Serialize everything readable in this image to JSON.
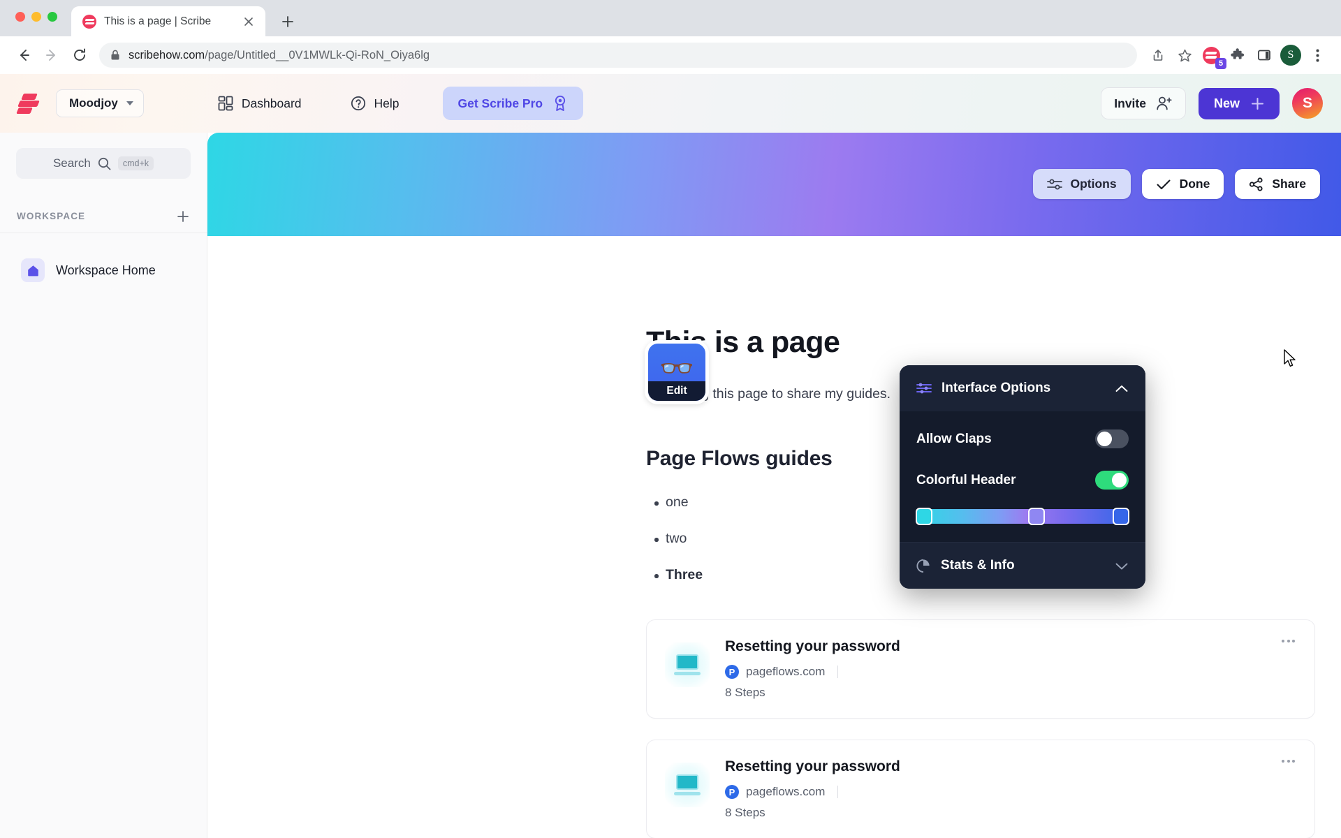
{
  "browser": {
    "tab": {
      "title": "This is a page | Scribe",
      "favicon": "scribe-favicon"
    },
    "new_tab_label": "+",
    "omnibox": {
      "url_domain": "scribehow.com",
      "url_path": "/page/Untitled__0V1MWLk-Qi-RoN_Oiya6lg",
      "lock_icon": "lock-icon"
    },
    "toolbar_icons": [
      {
        "name": "share-icon"
      },
      {
        "name": "bookmark-star-icon"
      },
      {
        "name": "scribe-extension-icon",
        "badge": "5"
      },
      {
        "name": "extensions-puzzle-icon"
      },
      {
        "name": "side-panel-icon"
      },
      {
        "name": "chrome-profile-avatar",
        "initial": "S"
      },
      {
        "name": "chrome-menu-icon"
      }
    ]
  },
  "app_header": {
    "logo": "scribe-logo",
    "workspace_name": "Moodjoy",
    "nav": [
      {
        "label": "Dashboard",
        "icon": "dashboard-grid-icon"
      },
      {
        "label": "Help",
        "icon": "question-circle-icon"
      }
    ],
    "pro_button": {
      "label": "Get Scribe Pro",
      "icon": "ribbon-badge-icon"
    },
    "invite_button": {
      "label": "Invite",
      "icon": "user-plus-icon"
    },
    "new_button": {
      "label": "New",
      "icon": "plus-icon"
    },
    "avatar_initial": "S"
  },
  "sidebar": {
    "search": {
      "label": "Search",
      "shortcut": "cmd+k",
      "icon": "search-icon"
    },
    "section_label": "WORKSPACE",
    "add_icon": "plus-icon",
    "items": [
      {
        "label": "Workspace Home",
        "icon": "home-icon"
      }
    ]
  },
  "cover": {
    "actions": [
      {
        "label": "Options",
        "icon": "sliders-icon",
        "active": true
      },
      {
        "label": "Done",
        "icon": "check-icon",
        "active": false
      },
      {
        "label": "Share",
        "icon": "share-nodes-icon",
        "active": false
      }
    ],
    "gradient_colors": [
      "#2ed7e5",
      "#7f9bf4",
      "#9c7bf0",
      "#4159e8"
    ]
  },
  "page": {
    "avatar_emoji": "👓",
    "avatar_edit_label": "Edit",
    "title": "This is a page",
    "description": "I am using this page to share my guides.",
    "heading2": "Page Flows guides",
    "bullets": [
      {
        "text": "one",
        "bold": false
      },
      {
        "text": "two",
        "bold": false
      },
      {
        "text": "Three",
        "bold": true
      }
    ],
    "cards": [
      {
        "title": "Resetting your password",
        "domain": "pageflows.com",
        "favicon_letter": "P",
        "steps": "8 Steps",
        "thumb_icon": "laptop-icon",
        "menu_icon": "more-horizontal-icon"
      },
      {
        "title": "Resetting your password",
        "domain": "pageflows.com",
        "favicon_letter": "P",
        "steps": "8 Steps",
        "thumb_icon": "laptop-icon",
        "menu_icon": "more-horizontal-icon"
      }
    ]
  },
  "options_panel": {
    "interface_section": {
      "title": "Interface Options",
      "icon": "sliders-icon",
      "chevron": "chevron-up-icon",
      "rows": [
        {
          "label": "Allow Claps",
          "toggle": "off"
        },
        {
          "label": "Colorful Header",
          "toggle": "on"
        }
      ],
      "gradient_stops": [
        "#2ed7e5",
        "#8f87f2",
        "#3566e8"
      ]
    },
    "stats_section": {
      "title": "Stats & Info",
      "icon": "pie-chart-icon",
      "chevron": "chevron-down-icon"
    }
  },
  "colors": {
    "accent_purple": "#4c35d4",
    "brand_red": "#ef3a5d",
    "toggle_on_green": "#2edb7c",
    "panel_bg": "#141b2b"
  }
}
